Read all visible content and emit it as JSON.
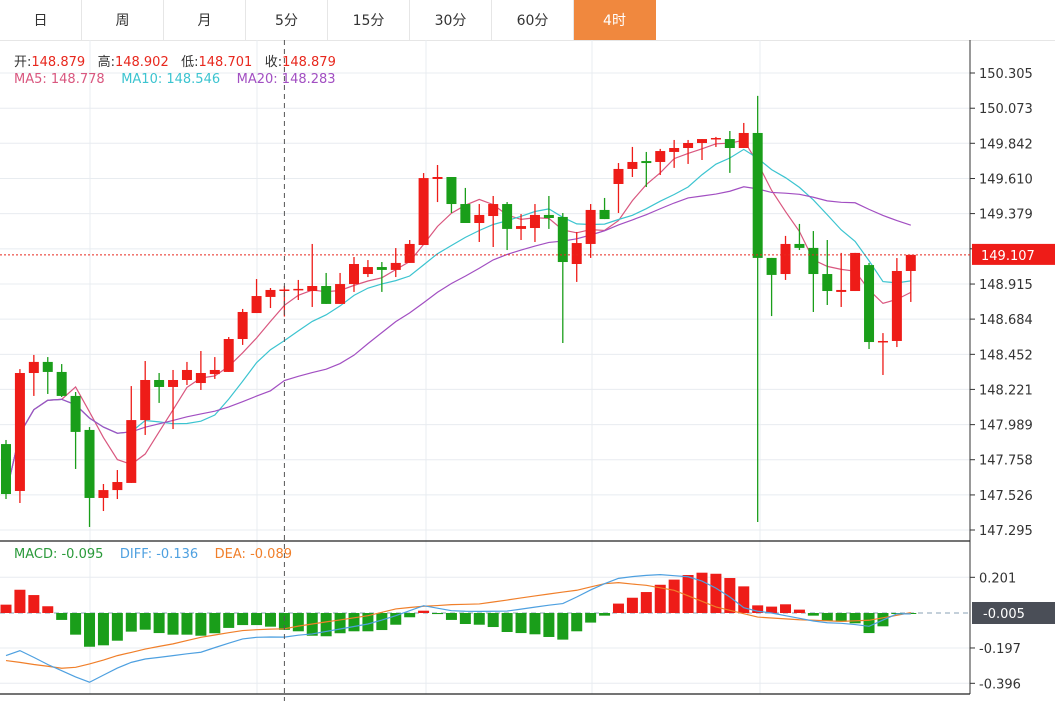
{
  "tabs": [
    {
      "label": "日",
      "active": false
    },
    {
      "label": "周",
      "active": false
    },
    {
      "label": "月",
      "active": false
    },
    {
      "label": "5分",
      "active": false
    },
    {
      "label": "15分",
      "active": false
    },
    {
      "label": "30分",
      "active": false
    },
    {
      "label": "60分",
      "active": false
    },
    {
      "label": "4时",
      "active": true
    }
  ],
  "ohlc_legend": {
    "open_label": "开:",
    "open": "148.879",
    "high_label": "高:",
    "high": "148.902",
    "low_label": "低:",
    "low": "148.701",
    "close_label": "收:",
    "close": "148.879"
  },
  "ma_legend": {
    "ma5": "MA5: 148.778",
    "ma10": "MA10: 148.546",
    "ma20": "MA20: 148.283"
  },
  "macd_legend": {
    "macd": "MACD: -0.095",
    "diff": "DIFF: -0.136",
    "dea": "DEA: -0.089"
  },
  "current_price": "149.107",
  "macd_current": "-0.005",
  "colors": {
    "up": "#ee1c18",
    "down": "#1a9e1a",
    "ma5": "#d9577f",
    "ma10": "#3cc4d0",
    "ma20": "#a24fc2",
    "macd": "#2a9a3a",
    "diff": "#4ea0e0",
    "dea": "#f07f2a",
    "tab_active": "#f0883e"
  },
  "chart_data": [
    {
      "type": "candlestick",
      "title": "4时 K线",
      "price_axis_labels": [
        "150.305",
        "150.073",
        "149.842",
        "149.610",
        "149.379",
        "149.147",
        "148.915",
        "148.684",
        "148.452",
        "148.221",
        "147.989",
        "147.758",
        "147.526",
        "147.295"
      ],
      "ylim": [
        147.295,
        150.305
      ],
      "crosshair_index": 20,
      "candles_ohlc": [
        [
          147.861,
          147.888,
          147.499,
          147.532
        ],
        [
          147.552,
          148.355,
          147.473,
          148.329
        ],
        [
          148.329,
          148.448,
          148.178,
          148.402
        ],
        [
          148.402,
          148.434,
          148.191,
          148.336
        ],
        [
          148.336,
          148.388,
          148.171,
          148.178
        ],
        [
          148.178,
          148.204,
          147.697,
          147.941
        ],
        [
          147.954,
          147.973,
          147.315,
          147.506
        ],
        [
          147.506,
          147.598,
          147.42,
          147.558
        ],
        [
          147.558,
          147.69,
          147.499,
          147.611
        ],
        [
          147.605,
          148.243,
          147.605,
          148.019
        ],
        [
          148.019,
          148.408,
          147.921,
          148.283
        ],
        [
          148.283,
          148.329,
          148.132,
          148.237
        ],
        [
          148.237,
          148.349,
          147.96,
          148.283
        ],
        [
          148.283,
          148.402,
          148.25,
          148.349
        ],
        [
          148.263,
          148.474,
          148.217,
          148.329
        ],
        [
          148.322,
          148.434,
          148.29,
          148.349
        ],
        [
          148.336,
          148.566,
          148.336,
          148.553
        ],
        [
          148.553,
          148.751,
          148.514,
          148.731
        ],
        [
          148.724,
          148.948,
          148.724,
          148.836
        ],
        [
          148.83,
          148.889,
          148.757,
          148.876
        ],
        [
          148.879,
          148.902,
          148.701,
          148.879
        ],
        [
          148.876,
          148.942,
          148.81,
          148.883
        ],
        [
          148.869,
          149.179,
          148.764,
          148.902
        ],
        [
          148.902,
          148.988,
          148.784,
          148.784
        ],
        [
          148.784,
          148.988,
          148.784,
          148.915
        ],
        [
          148.915,
          149.093,
          148.863,
          149.047
        ],
        [
          148.981,
          149.073,
          148.961,
          149.027
        ],
        [
          149.027,
          149.06,
          148.863,
          149.008
        ],
        [
          149.008,
          149.152,
          148.961,
          149.054
        ],
        [
          149.054,
          149.205,
          149.054,
          149.179
        ],
        [
          149.172,
          149.646,
          149.172,
          149.613
        ],
        [
          149.607,
          149.699,
          149.455,
          149.62
        ],
        [
          149.62,
          149.62,
          149.383,
          149.442
        ],
        [
          149.442,
          149.548,
          149.317,
          149.317
        ],
        [
          149.317,
          149.442,
          149.192,
          149.37
        ],
        [
          149.363,
          149.495,
          149.159,
          149.442
        ],
        [
          149.442,
          149.455,
          149.139,
          149.278
        ],
        [
          149.278,
          149.376,
          149.205,
          149.297
        ],
        [
          149.284,
          149.442,
          149.192,
          149.37
        ],
        [
          149.37,
          149.495,
          149.278,
          149.35
        ],
        [
          149.357,
          149.383,
          148.527,
          149.06
        ],
        [
          149.047,
          149.258,
          148.929,
          149.185
        ],
        [
          149.179,
          149.442,
          149.087,
          149.403
        ],
        [
          149.403,
          149.482,
          149.343,
          149.343
        ],
        [
          149.574,
          149.712,
          149.383,
          149.673
        ],
        [
          149.673,
          149.818,
          149.62,
          149.719
        ],
        [
          149.725,
          149.785,
          149.554,
          149.712
        ],
        [
          149.719,
          149.805,
          149.633,
          149.791
        ],
        [
          149.785,
          149.864,
          149.68,
          149.811
        ],
        [
          149.811,
          149.864,
          149.706,
          149.844
        ],
        [
          149.844,
          149.87,
          149.732,
          149.87
        ],
        [
          149.87,
          149.884,
          149.818,
          149.877
        ],
        [
          149.87,
          149.923,
          149.647,
          149.811
        ],
        [
          149.811,
          149.976,
          149.811,
          149.91
        ],
        [
          149.91,
          150.154,
          147.348,
          149.087
        ],
        [
          149.087,
          149.087,
          148.704,
          148.975
        ],
        [
          148.981,
          149.232,
          148.942,
          149.179
        ],
        [
          149.179,
          149.311,
          149.139,
          149.153
        ],
        [
          149.153,
          149.264,
          148.731,
          148.981
        ],
        [
          148.981,
          149.205,
          148.777,
          148.869
        ],
        [
          148.863,
          149.12,
          148.764,
          148.876
        ],
        [
          148.869,
          149.12,
          148.869,
          149.12
        ],
        [
          149.04,
          149.054,
          148.487,
          148.533
        ],
        [
          148.533,
          148.592,
          148.316,
          148.54
        ],
        [
          148.54,
          149.086,
          148.5,
          149.001
        ],
        [
          149.001,
          149.107,
          148.797,
          149.107
        ]
      ]
    },
    {
      "type": "bar+line",
      "title": "MACD",
      "axis_labels": [
        "0.201",
        "-0.197",
        "-0.396"
      ],
      "ylim": [
        -0.396,
        0.201
      ],
      "macd_hist": [
        0.047,
        0.131,
        0.101,
        0.038,
        -0.039,
        -0.122,
        -0.19,
        -0.182,
        -0.156,
        -0.105,
        -0.094,
        -0.113,
        -0.122,
        -0.122,
        -0.128,
        -0.114,
        -0.084,
        -0.068,
        -0.068,
        -0.077,
        -0.095,
        -0.103,
        -0.128,
        -0.131,
        -0.114,
        -0.103,
        -0.103,
        -0.096,
        -0.066,
        -0.024,
        0.013,
        -0.006,
        -0.039,
        -0.062,
        -0.066,
        -0.079,
        -0.107,
        -0.113,
        -0.12,
        -0.135,
        -0.15,
        -0.103,
        -0.054,
        -0.015,
        0.053,
        0.086,
        0.118,
        0.159,
        0.188,
        0.214,
        0.227,
        0.221,
        0.197,
        0.15,
        0.043,
        0.036,
        0.049,
        0.019,
        -0.015,
        -0.045,
        -0.049,
        -0.058,
        -0.113,
        -0.075,
        -0.005,
        -0.005
      ],
      "diff": [
        -0.24,
        -0.212,
        -0.25,
        -0.29,
        -0.325,
        -0.36,
        -0.39,
        -0.35,
        -0.31,
        -0.278,
        -0.259,
        -0.25,
        -0.24,
        -0.23,
        -0.221,
        -0.195,
        -0.17,
        -0.146,
        -0.137,
        -0.135,
        -0.136,
        -0.125,
        -0.118,
        -0.104,
        -0.09,
        -0.076,
        -0.062,
        -0.04,
        -0.015,
        0.013,
        0.041,
        0.027,
        0.013,
        0.01,
        0.009,
        0.01,
        0.011,
        0.022,
        0.033,
        0.044,
        0.053,
        0.09,
        0.13,
        0.165,
        0.195,
        0.205,
        0.212,
        0.216,
        0.21,
        0.204,
        0.18,
        0.14,
        0.09,
        0.03,
        0.01,
        0.0,
        -0.015,
        -0.03,
        -0.045,
        -0.055,
        -0.058,
        -0.065,
        -0.075,
        -0.04,
        -0.005,
        -0.005
      ],
      "dea": [
        -0.268,
        -0.278,
        -0.29,
        -0.3,
        -0.311,
        -0.306,
        -0.287,
        -0.265,
        -0.24,
        -0.222,
        -0.203,
        -0.188,
        -0.174,
        -0.155,
        -0.137,
        -0.124,
        -0.111,
        -0.099,
        -0.094,
        -0.091,
        -0.089,
        -0.074,
        -0.062,
        -0.05,
        -0.039,
        -0.027,
        -0.015,
        0.004,
        0.023,
        0.031,
        0.038,
        0.042,
        0.047,
        0.049,
        0.051,
        0.062,
        0.073,
        0.085,
        0.096,
        0.107,
        0.118,
        0.128,
        0.147,
        0.165,
        0.171,
        0.163,
        0.156,
        0.142,
        0.128,
        0.097,
        0.066,
        0.034,
        0.015,
        -0.004,
        -0.023,
        -0.028,
        -0.033,
        -0.038,
        -0.041,
        -0.044,
        -0.047,
        -0.044,
        -0.041,
        -0.027,
        -0.013,
        0.002
      ]
    }
  ]
}
